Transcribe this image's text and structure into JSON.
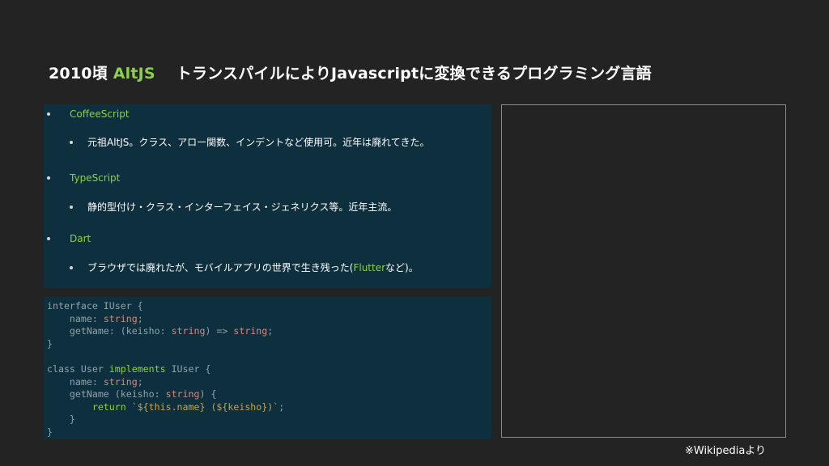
{
  "slide": {
    "title_year": "2010頃",
    "title_topic": "AltJS",
    "title_desc": "トランスパイルによりJavascriptに変換できるプログラミング言語"
  },
  "list": [
    {
      "label": "CoffeeScript",
      "desc": "元祖AltJS。クラス、アロー関数、インデントなど使用可。近年は廃れてきた。"
    },
    {
      "label": "TypeScript",
      "desc": "静的型付け・クラス・インターフェイス・ジェネリクス等。近年主流。"
    },
    {
      "label": "Dart",
      "desc_pre": "ブラウザでは廃れたが、モバイルアプリの世界で生き残った(",
      "desc_hl": "Flutter",
      "desc_post": "など)。"
    }
  ],
  "code": {
    "l1a": "interface IUser {",
    "l2a": "    name: ",
    "l2b": "string",
    "l2c": ";",
    "l3a": "    getName: (keisho: ",
    "l3b": "string",
    "l3c": ") => ",
    "l3d": "string",
    "l3e": ";",
    "l4a": "}",
    "l6a": "class User ",
    "l6b": "implements",
    "l6c": " IUser {",
    "l7a": "    name: ",
    "l7b": "string",
    "l7c": ";",
    "l8a": "    getName (keisho: ",
    "l8b": "string",
    "l8c": ") {",
    "l9a": "        ",
    "l9b": "return",
    "l9c": " ",
    "l9d": "`${this.name} (${keisho})`",
    "l9e": ";",
    "l10a": "    }",
    "l11a": "}"
  },
  "footnote": "※Wikipediaより",
  "colors": {
    "background": "#232323",
    "panel": "#0e2f3d",
    "accent_green": "#8ccf4d",
    "code_type": "#d38a7e",
    "code_string": "#c9a24a"
  }
}
